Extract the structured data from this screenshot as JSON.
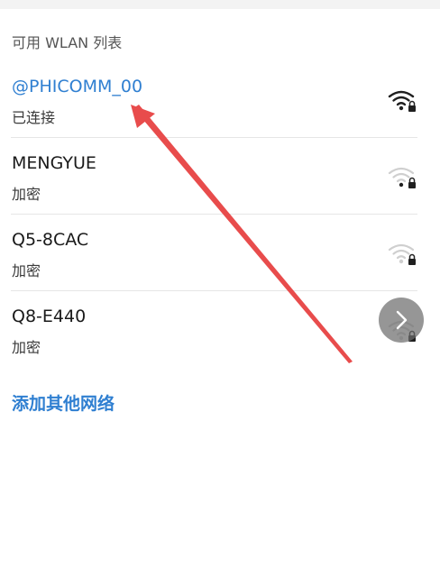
{
  "section_title": "可用 WLAN 列表",
  "networks": [
    {
      "name": "@PHICOMM_00",
      "status": "已连接",
      "icon": "wifi-lock-icon",
      "connected": true,
      "signal": "strong"
    },
    {
      "name": "MENGYUE",
      "status": "加密",
      "icon": "wifi-lock-icon",
      "connected": false,
      "signal": "weak"
    },
    {
      "name": "Q5-8CAC",
      "status": "加密",
      "icon": "wifi-lock-icon",
      "connected": false,
      "signal": "weak"
    },
    {
      "name": "Q8-E440",
      "status": "加密",
      "icon": "wifi-lock-icon",
      "connected": false,
      "signal": "weak"
    }
  ],
  "add_network_label": "添加其他网络",
  "floating_button_icon": "chevron-right-icon",
  "annotation": {
    "type": "arrow",
    "color": "#e84c4c",
    "points_to": "@PHICOMM_00"
  },
  "colors": {
    "accent": "#2f7fd1",
    "annotation": "#e84c4c"
  }
}
